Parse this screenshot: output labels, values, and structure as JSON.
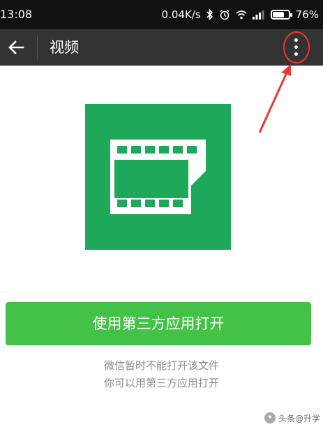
{
  "status_bar": {
    "time": "13:08",
    "network_speed": "0.04K/s",
    "battery_percent": "76%",
    "battery_level": 0.76,
    "icons": [
      "bluetooth-icon",
      "alarm-icon",
      "wifi-icon",
      "signal-icon",
      "battery-icon"
    ]
  },
  "title_bar": {
    "back_icon": "back-arrow-icon",
    "title": "视频",
    "more_icon": "more-vertical-icon"
  },
  "file": {
    "icon": "video-file-icon"
  },
  "open_button": {
    "label": "使用第三方应用打开"
  },
  "hint": {
    "line1": "微信暂时不能打开该文件",
    "line2": "你可以用第三方应用打开"
  },
  "watermark": {
    "text": "头条@升学"
  },
  "colors": {
    "status_bar_bg": "#111111",
    "title_bar_bg": "#333333",
    "file_icon_green": "#1ea95a",
    "button_green": "#44c147",
    "annotation_red": "#e53935",
    "hint_gray": "#8c8c8c"
  }
}
